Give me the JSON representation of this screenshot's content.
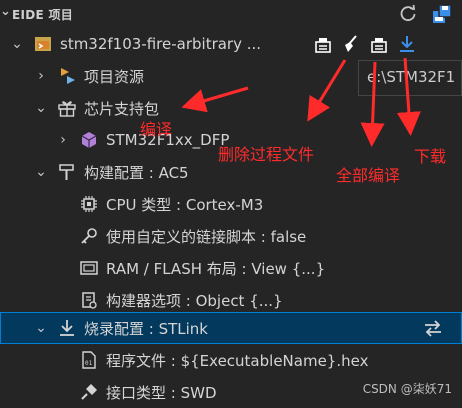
{
  "panel": {
    "title": "EIDE 项目"
  },
  "icons": {
    "refresh": "refresh-icon",
    "save": "save-icon",
    "build": "build-icon",
    "clean": "clean-icon",
    "download": "download-icon"
  },
  "project": {
    "name": "stm32f103-fire-arbitrary ..."
  },
  "tree": {
    "resources": "项目资源",
    "chip_pkg": "芯片支持包",
    "dfp": "STM32F1xx_DFP",
    "build_config": "构建配置 : AC5",
    "cpu": "CPU 类型 : Cortex-M3",
    "linker": "使用自定义的链接脚本 : false",
    "ram_flash": "RAM / FLASH 布局 : View {...}",
    "builder_opts": "构建器选项 : Object {...}",
    "flash_config": "烧录配置 : STLink",
    "program_file": "程序文件 : ${ExecutableName}.hex",
    "interface": "接口类型 : SWD"
  },
  "tooltip": {
    "text": "e:\\STM32F1"
  },
  "annotations": {
    "compile": "编译",
    "delete_build": "删除过程文件",
    "full_compile": "全部编译",
    "download": "下载"
  },
  "watermark": "CSDN @柒妖71",
  "colors": {
    "accent_red": "#ff2b2b",
    "selection": "#04395e",
    "selection_border": "#007fd4"
  }
}
